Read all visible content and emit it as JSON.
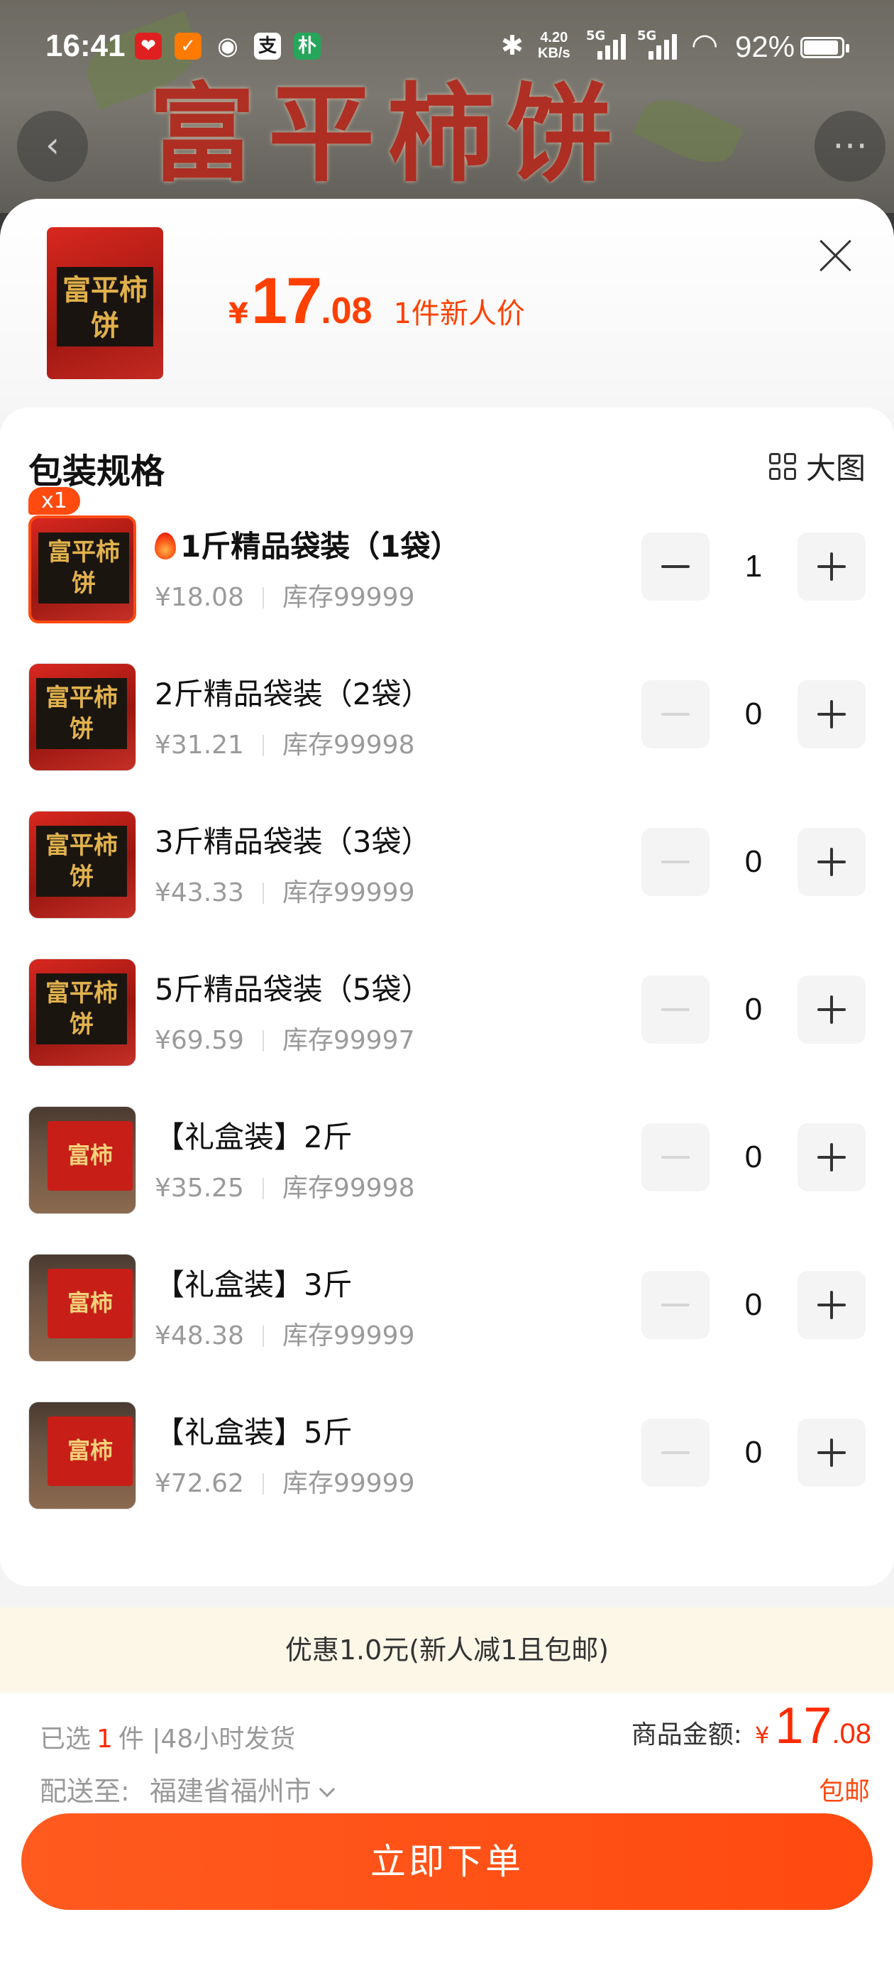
{
  "status_bar": {
    "time": "16:41",
    "net_speed_value": "4.20",
    "net_speed_unit": "KB/s",
    "battery": "92%",
    "battery_level": 0.92,
    "app_icons": [
      "pinduoduo-icon",
      "taobao-icon",
      "wechat-icon",
      "alipay-icon",
      "app-icon"
    ]
  },
  "background": {
    "title": "富平柿饼"
  },
  "sheet": {
    "price_symbol": "¥",
    "price_int": "17",
    "price_dec": ".08",
    "price_note": "1件新人价",
    "thumb_text": "富平柿饼"
  },
  "spec": {
    "title": "包装规格",
    "bigpic_label": "大图",
    "items": [
      {
        "name": "1斤精品袋装（1袋）",
        "price": "¥18.08",
        "stock": "库存99999",
        "qty": "1",
        "img": "bag",
        "thumb_text": "富平柿饼",
        "badge": "x1",
        "hot": true
      },
      {
        "name": "2斤精品袋装（2袋）",
        "price": "¥31.21",
        "stock": "库存99998",
        "qty": "0",
        "img": "bag",
        "thumb_text": "富平柿饼"
      },
      {
        "name": "3斤精品袋装（3袋）",
        "price": "¥43.33",
        "stock": "库存99999",
        "qty": "0",
        "img": "bag",
        "thumb_text": "富平柿饼"
      },
      {
        "name": "5斤精品袋装（5袋）",
        "price": "¥69.59",
        "stock": "库存99997",
        "qty": "0",
        "img": "bag",
        "thumb_text": "富平柿饼"
      },
      {
        "name": "【礼盒装】2斤",
        "price": "¥35.25",
        "stock": "库存99998",
        "qty": "0",
        "img": "box",
        "thumb_text": "富柿"
      },
      {
        "name": "【礼盒装】3斤",
        "price": "¥48.38",
        "stock": "库存99999",
        "qty": "0",
        "img": "box",
        "thumb_text": "富柿"
      },
      {
        "name": "【礼盒装】5斤",
        "price": "¥72.62",
        "stock": "库存99999",
        "qty": "0",
        "img": "box",
        "thumb_text": "富柿"
      }
    ]
  },
  "promo": {
    "text": "优惠1.0元(新人减1且包邮)"
  },
  "footer": {
    "selected_prefix": "已选",
    "selected_count": "1",
    "selected_suffix": "件 |48小时发货",
    "deliver_label": "配送至:",
    "deliver_address": "福建省福州市",
    "total_label": "商品金额:",
    "total_symbol": "¥",
    "total_int": "17",
    "total_dec": ".08",
    "free_shipping": "包邮",
    "order_button": "立即下单"
  },
  "colors": {
    "accent": "#ff4a10",
    "price": "#ff4000",
    "promo_bg": "#fdf7e8"
  }
}
